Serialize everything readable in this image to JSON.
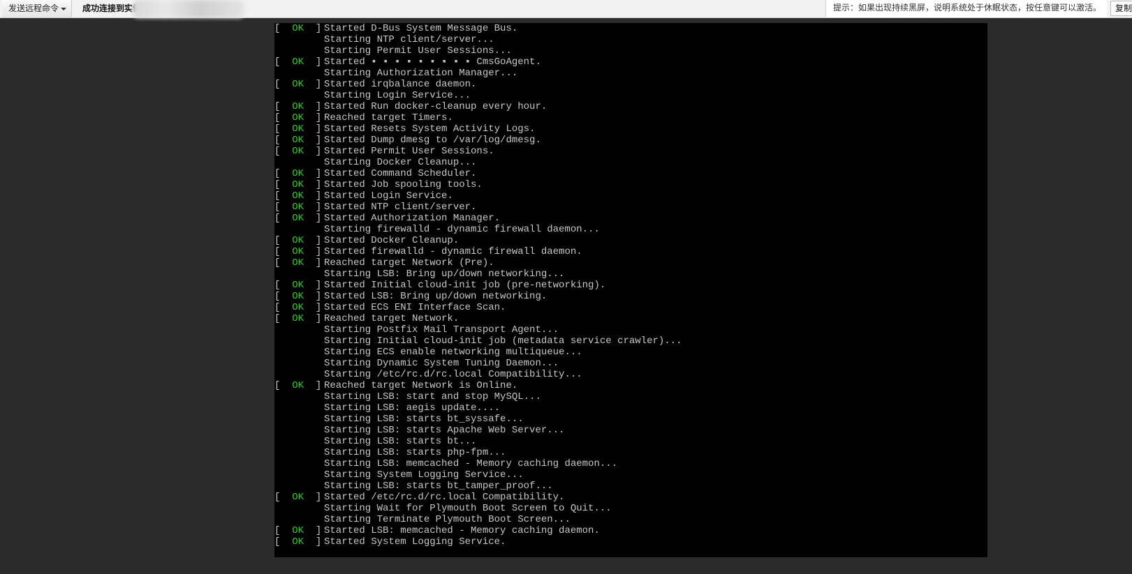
{
  "toolbar": {
    "send_command_label": "发送远程命令",
    "connection_status": "成功连接到实例",
    "hint": "提示：如果出现持续黑屏，说明系统处于休眠状态，按任意键可以激活。",
    "copy_label": "复制"
  },
  "console": {
    "ok_label": "OK",
    "lines": [
      {
        "ok": true,
        "text": "Started D-Bus System Message Bus."
      },
      {
        "ok": false,
        "text": "Starting NTP client/server..."
      },
      {
        "ok": false,
        "text": "Starting Permit User Sessions..."
      },
      {
        "ok": true,
        "text": "Started ▪ ▪ ▪ ▪ ▪ ▪ ▪ ▪ ▪ CmsGoAgent."
      },
      {
        "ok": false,
        "text": "Starting Authorization Manager..."
      },
      {
        "ok": true,
        "text": "Started irqbalance daemon."
      },
      {
        "ok": false,
        "text": "Starting Login Service..."
      },
      {
        "ok": true,
        "text": "Started Run docker-cleanup every hour."
      },
      {
        "ok": true,
        "text": "Reached target Timers."
      },
      {
        "ok": true,
        "text": "Started Resets System Activity Logs."
      },
      {
        "ok": true,
        "text": "Started Dump dmesg to /var/log/dmesg."
      },
      {
        "ok": true,
        "text": "Started Permit User Sessions."
      },
      {
        "ok": false,
        "text": "Starting Docker Cleanup..."
      },
      {
        "ok": true,
        "text": "Started Command Scheduler."
      },
      {
        "ok": true,
        "text": "Started Job spooling tools."
      },
      {
        "ok": true,
        "text": "Started Login Service."
      },
      {
        "ok": true,
        "text": "Started NTP client/server."
      },
      {
        "ok": true,
        "text": "Started Authorization Manager."
      },
      {
        "ok": false,
        "text": "Starting firewalld - dynamic firewall daemon..."
      },
      {
        "ok": true,
        "text": "Started Docker Cleanup."
      },
      {
        "ok": true,
        "text": "Started firewalld - dynamic firewall daemon."
      },
      {
        "ok": true,
        "text": "Reached target Network (Pre)."
      },
      {
        "ok": false,
        "text": "Starting LSB: Bring up/down networking..."
      },
      {
        "ok": true,
        "text": "Started Initial cloud-init job (pre-networking)."
      },
      {
        "ok": true,
        "text": "Started LSB: Bring up/down networking."
      },
      {
        "ok": true,
        "text": "Started ECS ENI Interface Scan."
      },
      {
        "ok": true,
        "text": "Reached target Network."
      },
      {
        "ok": false,
        "text": "Starting Postfix Mail Transport Agent..."
      },
      {
        "ok": false,
        "text": "Starting Initial cloud-init job (metadata service crawler)..."
      },
      {
        "ok": false,
        "text": "Starting ECS enable networking multiqueue..."
      },
      {
        "ok": false,
        "text": "Starting Dynamic System Tuning Daemon..."
      },
      {
        "ok": false,
        "text": "Starting /etc/rc.d/rc.local Compatibility..."
      },
      {
        "ok": true,
        "text": "Reached target Network is Online."
      },
      {
        "ok": false,
        "text": "Starting LSB: start and stop MySQL..."
      },
      {
        "ok": false,
        "text": "Starting LSB: aegis update...."
      },
      {
        "ok": false,
        "text": "Starting LSB: starts bt_syssafe..."
      },
      {
        "ok": false,
        "text": "Starting LSB: starts Apache Web Server..."
      },
      {
        "ok": false,
        "text": "Starting LSB: starts bt..."
      },
      {
        "ok": false,
        "text": "Starting LSB: starts php-fpm..."
      },
      {
        "ok": false,
        "text": "Starting LSB: memcached - Memory caching daemon..."
      },
      {
        "ok": false,
        "text": "Starting System Logging Service..."
      },
      {
        "ok": false,
        "text": "Starting LSB: starts bt_tamper_proof..."
      },
      {
        "ok": true,
        "text": "Started /etc/rc.d/rc.local Compatibility."
      },
      {
        "ok": false,
        "text": "Starting Wait for Plymouth Boot Screen to Quit..."
      },
      {
        "ok": false,
        "text": "Starting Terminate Plymouth Boot Screen..."
      },
      {
        "ok": true,
        "text": "Started LSB: memcached - Memory caching daemon."
      },
      {
        "ok": true,
        "text": "Started System Logging Service."
      }
    ]
  }
}
